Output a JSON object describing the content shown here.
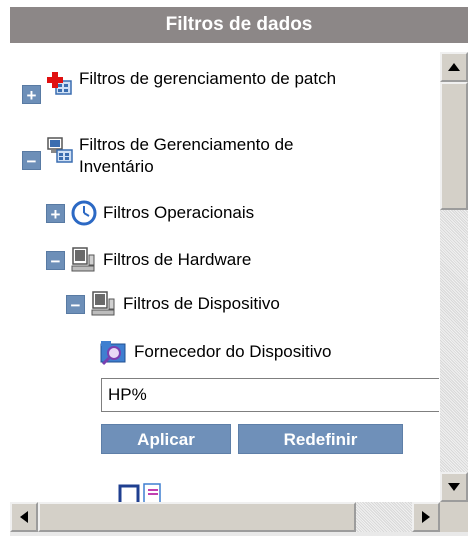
{
  "panel": {
    "title": "Filtros de dados"
  },
  "tree": {
    "items": [
      {
        "label": "Filtros de gerenciamento de patch",
        "expander": "+",
        "icon": "patch-icon"
      },
      {
        "label": "Filtros de Gerenciamento de Inventário",
        "expander": "−",
        "icon": "inventory-icon"
      },
      {
        "label": "Filtros Operacionais",
        "expander": "+",
        "icon": "clock-icon"
      },
      {
        "label": "Filtros de Hardware",
        "expander": "−",
        "icon": "computer-icon"
      },
      {
        "label": "Filtros de Dispositivo",
        "expander": "−",
        "icon": "computer-icon"
      },
      {
        "label": "Fornecedor do Dispositivo",
        "icon": "search-folder-icon"
      }
    ]
  },
  "filter": {
    "value": "HP%"
  },
  "buttons": {
    "apply": "Aplicar",
    "reset": "Redefinir"
  },
  "colors": {
    "title_bar": "#8c8787",
    "button": "#6f90b9",
    "expander": "#6d8fb8"
  }
}
